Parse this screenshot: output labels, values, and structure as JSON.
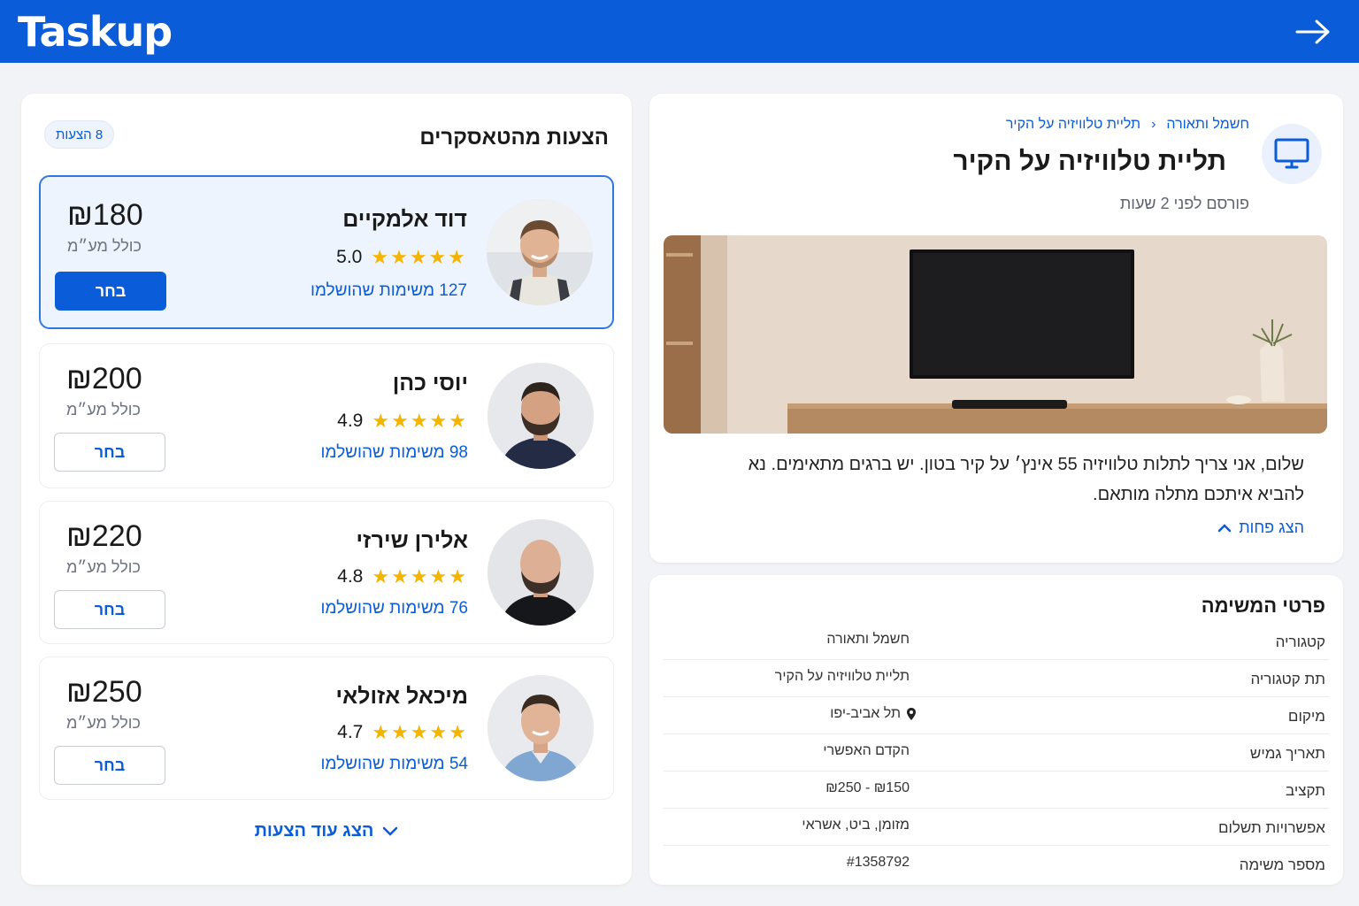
{
  "app": {
    "name": "Taskup"
  },
  "offers_panel": {
    "title": "הצעות מהטאסקרים",
    "count_badge": "8 הצעות",
    "show_more": "הצג עוד הצעות",
    "offers": [
      {
        "name": "דוד אלמקיים",
        "rating": "5.0",
        "stars": 5,
        "tasks": "127 משימות שהושלמו",
        "price": "₪180",
        "price_note": "כולל מע״מ",
        "button": "בחר",
        "selected": true
      },
      {
        "name": "יוסי כהן",
        "rating": "4.9",
        "stars": 5,
        "tasks": "98 משימות שהושלמו",
        "price": "₪200",
        "price_note": "כולל מע״מ",
        "button": "בחר",
        "selected": false
      },
      {
        "name": "אלירן שירזי",
        "rating": "4.8",
        "stars": 5,
        "tasks": "76 משימות שהושלמו",
        "price": "₪220",
        "price_note": "כולל מע״מ",
        "button": "בחר",
        "selected": false
      },
      {
        "name": "מיכאל אזולאי",
        "rating": "4.7",
        "stars": 5,
        "tasks": "54 משימות שהושלמו",
        "price": "₪250",
        "price_note": "כולל מע״מ",
        "button": "בחר",
        "selected": false
      }
    ]
  },
  "task": {
    "breadcrumb": [
      "חשמל ותאורה",
      "תליית טלוויזיה על הקיר"
    ],
    "title": "תליית טלוויזיה על הקיר",
    "posted": "פורסם לפני 2 שעות",
    "description": "שלום, אני צריך לתלות טלוויזיה 55 אינץ׳ על קיר בטון. יש ברגים מתאימים. נא להביא איתכם מתלה מותאם.",
    "show_less": "הצג פחות",
    "icon": "monitor-icon"
  },
  "details": {
    "title": "פרטי המשימה",
    "rows": [
      {
        "label": "קטגוריה",
        "value": "חשמל ותאורה"
      },
      {
        "label": "תת קטגוריה",
        "value": "תליית טלוויזיה על הקיר"
      },
      {
        "label": "מיקום",
        "value": "תל אביב-יפו"
      },
      {
        "label": "תאריך גמיש",
        "value": "הקדם האפשרי"
      },
      {
        "label": "תקציב",
        "value": "₪150 - ₪250"
      },
      {
        "label": "אפשרויות תשלום",
        "value": "מזומן, ביט, אשראי"
      },
      {
        "label": "מספר משימה",
        "value": "#1358792"
      }
    ]
  },
  "colors": {
    "brand": "#0b5cd9",
    "star": "#f5b400",
    "background": "#f2f3f6"
  }
}
